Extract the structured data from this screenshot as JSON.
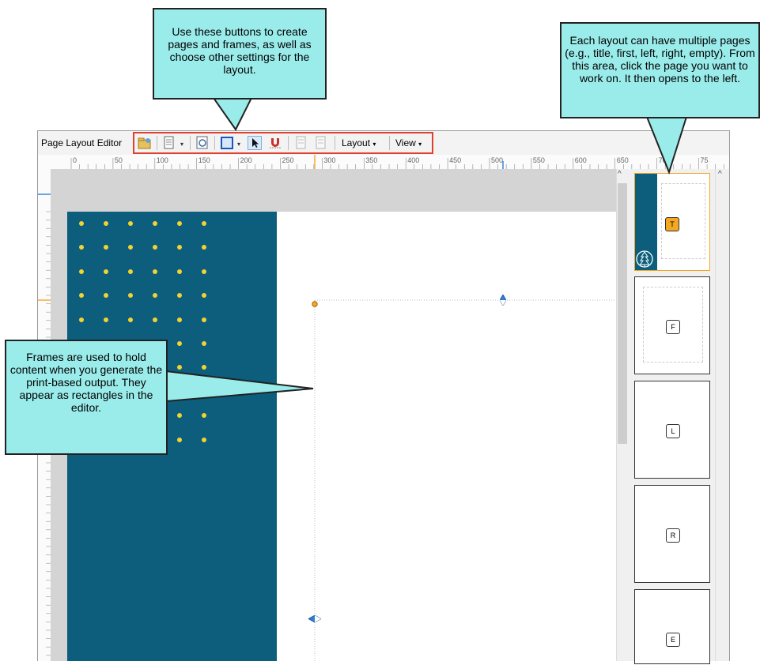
{
  "editor": {
    "title": "Page Layout Editor",
    "layout_menu": "Layout",
    "view_menu": "View",
    "dropdown_glyph": "▾"
  },
  "ruler": {
    "ticks": [
      "0",
      "50",
      "100",
      "150",
      "200",
      "250",
      "300",
      "350",
      "400",
      "450",
      "500",
      "550",
      "600",
      "650",
      "700",
      "75"
    ]
  },
  "thumbnails": [
    {
      "badge": "T",
      "selected": true
    },
    {
      "badge": "F",
      "selected": false
    },
    {
      "badge": "L",
      "selected": false
    },
    {
      "badge": "R",
      "selected": false
    },
    {
      "badge": "E",
      "selected": false
    }
  ],
  "callouts": {
    "toolbar": "Use these buttons to create pages and frames, as well as choose other settings for the layout.",
    "pages": "Each layout can have multiple pages (e.g., title, first, left, right, empty). From this area, click the page you want to work on. It then opens to the left.",
    "frames": "Frames are used to hold content when you generate the print-based output. They appear as rectangles in the editor."
  },
  "colors": {
    "callout_fill": "#9aeceb",
    "highlight_border": "#e0412f",
    "brand_panel": "#0c5e7c",
    "dot": "#f3d232",
    "selected_badge": "#f5a623"
  }
}
